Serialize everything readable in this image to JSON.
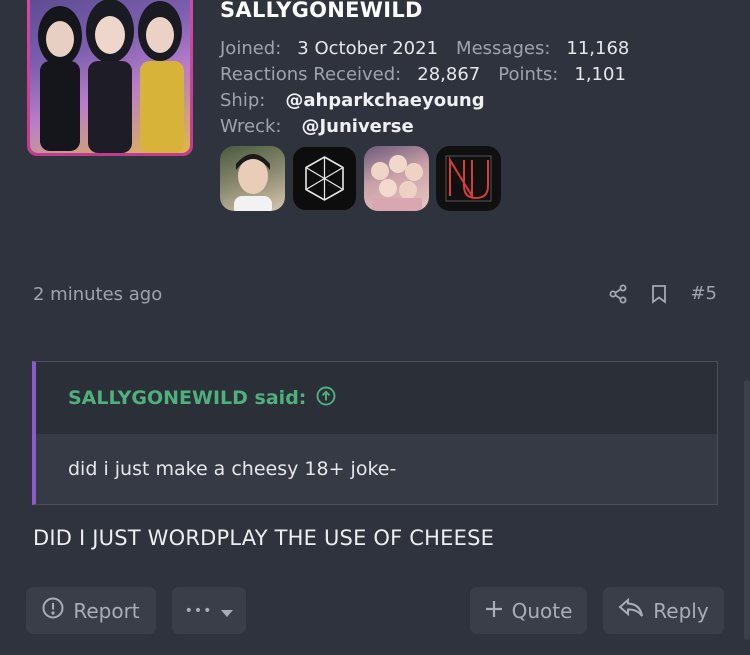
{
  "profile": {
    "username": "SALLYGONEWILD",
    "joined_label": "Joined:",
    "joined_value": "3 October 2021",
    "messages_label": "Messages:",
    "messages_value": "11,168",
    "reactions_label": "Reactions Received:",
    "reactions_value": "28,867",
    "points_label": "Points:",
    "points_value": "1,101",
    "ship_label": "Ship:",
    "ship_value": "@ahparkchaeyoung",
    "wreck_label": "Wreck:",
    "wreck_value": "@Juniverse",
    "badges": [
      "badge-portrait",
      "badge-hexagon-logo",
      "badge-group-photo",
      "badge-red-letter-logo"
    ]
  },
  "post": {
    "timestamp": "2 minutes ago",
    "number": "#5"
  },
  "quote": {
    "author_said": "SALLYGONEWILD said:",
    "text": "did i just make a cheesy 18+ joke-"
  },
  "message": {
    "text": "DID I JUST WORDPLAY THE USE OF CHEESE"
  },
  "actions": {
    "report": "Report",
    "more": "•••",
    "quote": "Quote",
    "reply": "Reply"
  },
  "colors": {
    "background": "#2f333d",
    "quote_accent": "#8b5cc8",
    "quote_author": "#4fb07d",
    "avatar_border": "#d44aa5"
  },
  "icons": [
    "share-icon",
    "bookmark-icon",
    "arrow-up-circle-icon",
    "alert-circle-icon",
    "caret-down-icon",
    "plus-icon",
    "reply-arrow-icon"
  ]
}
